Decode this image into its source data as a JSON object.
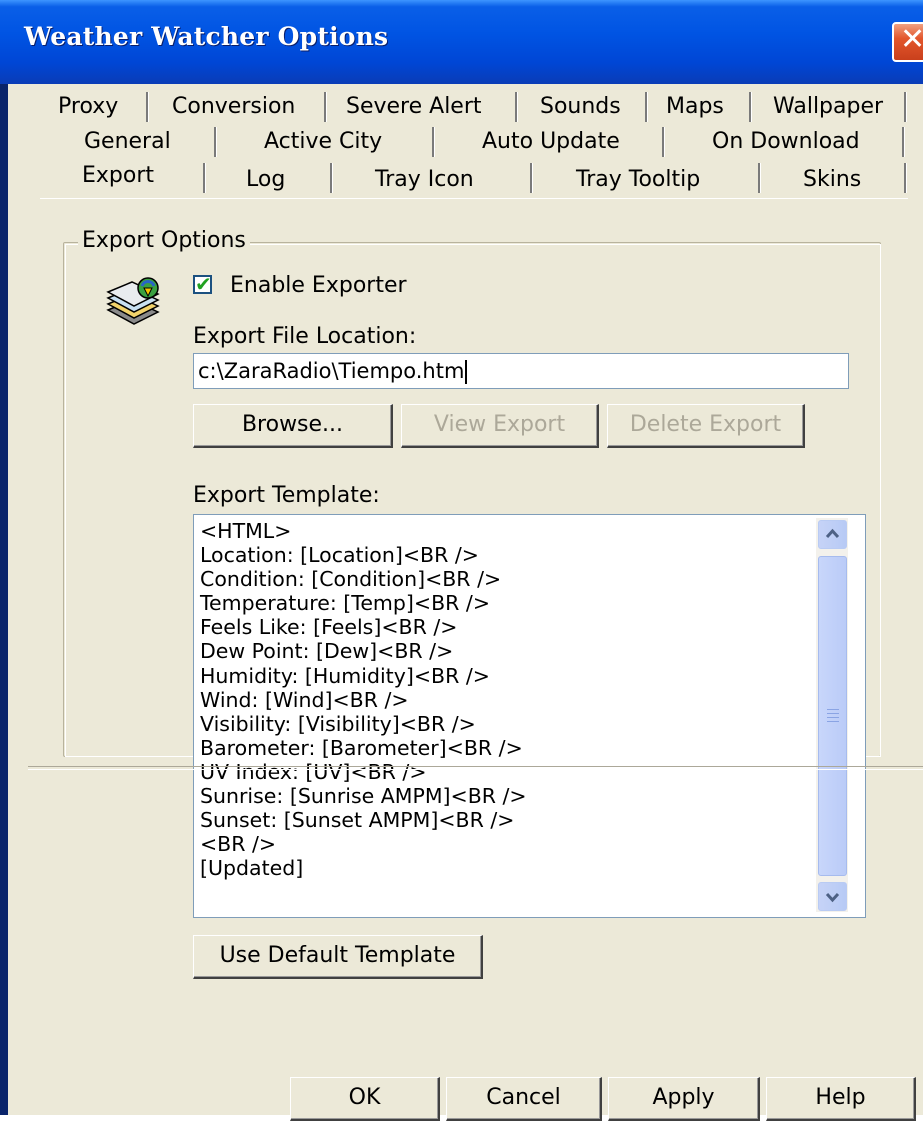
{
  "window": {
    "title": "Weather Watcher Options",
    "close_glyph": "✕"
  },
  "tabs": {
    "row1": [
      "Proxy",
      "Conversion",
      "Severe Alert",
      "Sounds",
      "Maps",
      "Wallpaper"
    ],
    "row2": [
      "General",
      "Active City",
      "Auto Update",
      "On Download"
    ],
    "row3": [
      "Export",
      "Log",
      "Tray Icon",
      "Tray Tooltip",
      "Skins"
    ],
    "active": "Export"
  },
  "export_options": {
    "group_label": "Export Options",
    "icon": "export-stack-icon",
    "enable_exporter": {
      "label": "Enable Exporter",
      "checked": true
    },
    "file_location": {
      "label": "Export File Location:",
      "value": "c:\\ZaraRadio\\Tiempo.htm"
    },
    "buttons": {
      "browse": "Browse...",
      "view": "View Export",
      "delete": "Delete Export"
    },
    "template": {
      "label": "Export Template:",
      "lines": [
        "<HTML>",
        "Location: [Location]<BR />",
        "Condition: [Condition]<BR />",
        "Temperature: [Temp]<BR />",
        "Feels Like: [Feels]<BR />",
        "Dew Point: [Dew]<BR />",
        "Humidity: [Humidity]<BR />",
        "Wind: [Wind]<BR />",
        "Visibility: [Visibility]<BR />",
        "Barometer: [Barometer]<BR />",
        "UV Index: [UV]<BR />",
        "Sunrise: [Sunrise AMPM]<BR />",
        "Sunset: [Sunset AMPM]<BR />",
        "<BR />",
        "[Updated]"
      ]
    },
    "use_default_button": "Use Default Template"
  },
  "footer": {
    "ok": "OK",
    "cancel": "Cancel",
    "apply": "Apply",
    "help": "Help"
  },
  "colors": {
    "titlebar": "#0054e3",
    "dialog_bg": "#ece9d8",
    "checkmark": "#21a121",
    "close": "#e3562c"
  }
}
